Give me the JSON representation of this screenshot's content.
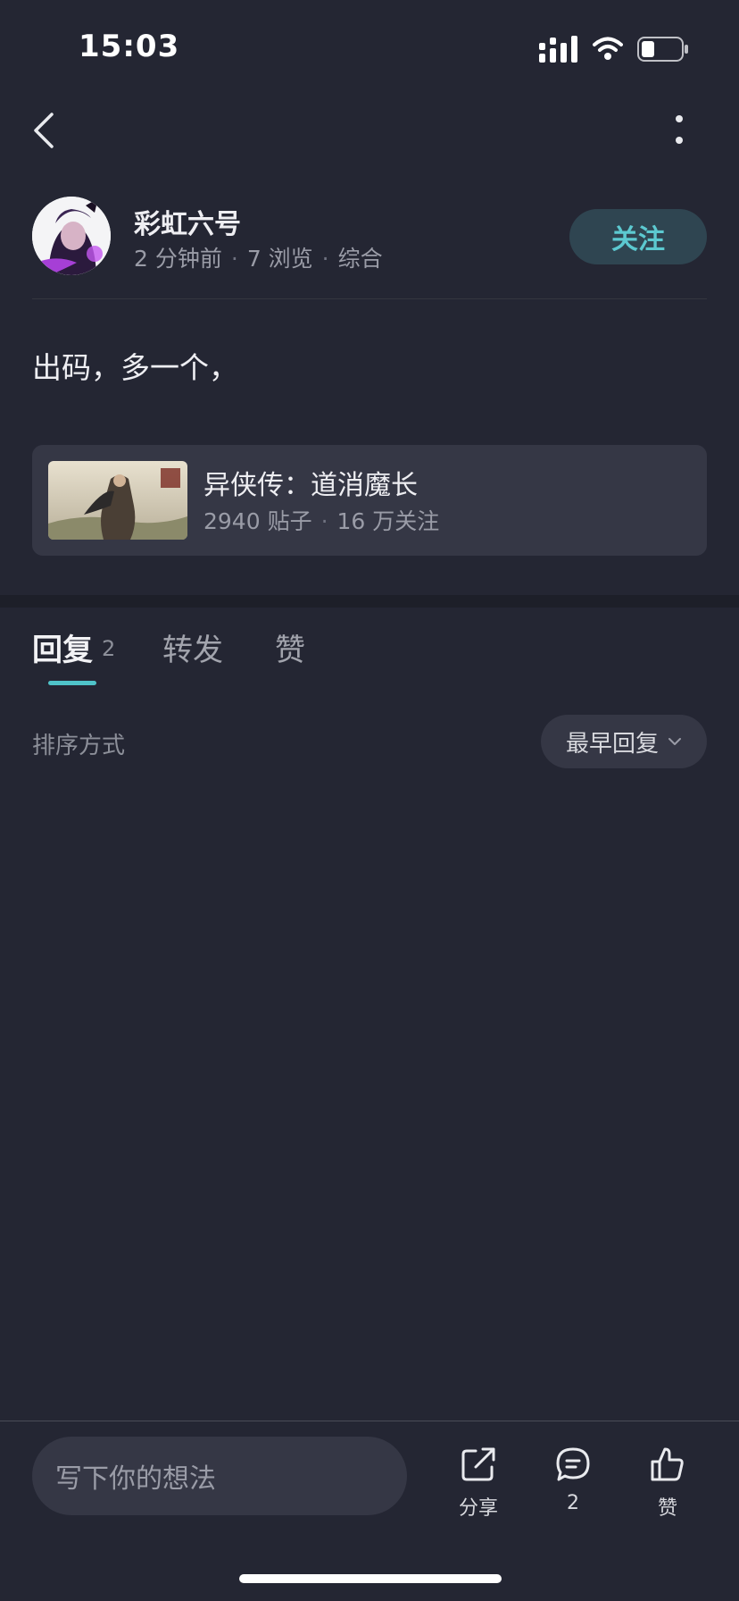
{
  "status_bar": {
    "time": "15:03"
  },
  "author": {
    "name": "彩虹六号",
    "time_ago": "2 分钟前",
    "views": "7 浏览",
    "category": "综合",
    "follow_label": "关注"
  },
  "post": {
    "text": "出码，多一个，"
  },
  "game_card": {
    "title": "异侠传：道消魔长",
    "posts": "2940 贴子",
    "followers": "16 万关注"
  },
  "tabs": {
    "reply_label": "回复",
    "reply_count": "2",
    "forward_label": "转发",
    "like_label": "赞"
  },
  "sort": {
    "label": "排序方式",
    "value": "最早回复"
  },
  "bottom_bar": {
    "input_placeholder": "写下你的想法",
    "share_label": "分享",
    "comment_count": "2",
    "like_label": "赞"
  },
  "colors": {
    "background": "#242633",
    "accent": "#4fc3c9",
    "card": "#353745"
  }
}
